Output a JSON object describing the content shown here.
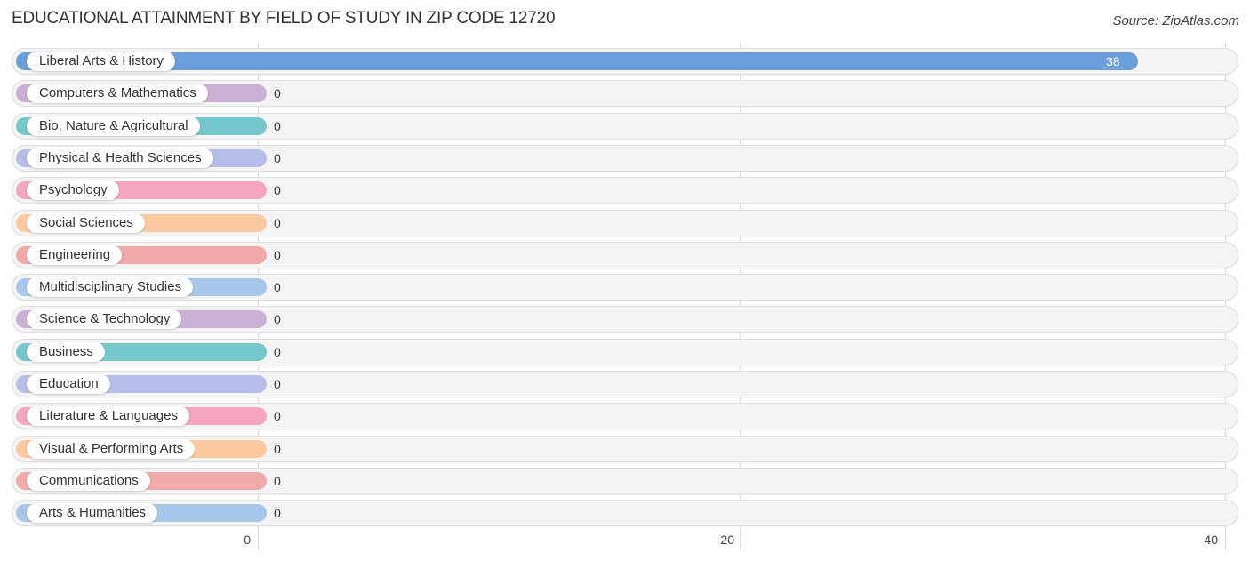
{
  "title": "EDUCATIONAL ATTAINMENT BY FIELD OF STUDY IN ZIP CODE 12720",
  "source": "Source: ZipAtlas.com",
  "chart_data": {
    "type": "bar",
    "orientation": "horizontal",
    "title": "EDUCATIONAL ATTAINMENT BY FIELD OF STUDY IN ZIP CODE 12720",
    "xlabel": "",
    "ylabel": "",
    "xlim": [
      0,
      40
    ],
    "xticks": [
      0,
      20,
      40
    ],
    "xtick_labels": [
      "0",
      "20",
      "40"
    ],
    "grid": true,
    "categories": [
      "Liberal Arts & History",
      "Computers & Mathematics",
      "Bio, Nature & Agricultural",
      "Physical & Health Sciences",
      "Psychology",
      "Social Sciences",
      "Engineering",
      "Multidisciplinary Studies",
      "Science & Technology",
      "Business",
      "Education",
      "Literature & Languages",
      "Visual & Performing Arts",
      "Communications",
      "Arts & Humanities"
    ],
    "values": [
      38,
      0,
      0,
      0,
      0,
      0,
      0,
      0,
      0,
      0,
      0,
      0,
      0,
      0,
      0
    ],
    "value_labels": [
      "38",
      "0",
      "0",
      "0",
      "0",
      "0",
      "0",
      "0",
      "0",
      "0",
      "0",
      "0",
      "0",
      "0",
      "0"
    ],
    "colors": [
      "#6a9fdc",
      "#c9b1d5",
      "#74c7cc",
      "#b6bdeb",
      "#f4a6c1",
      "#fbc99d",
      "#f0aaaa",
      "#a7c6eb",
      "#c9b1d5",
      "#74c7cc",
      "#b6bdeb",
      "#f4a6c1",
      "#fbc99d",
      "#f0aaaa",
      "#a7c6eb"
    ]
  }
}
